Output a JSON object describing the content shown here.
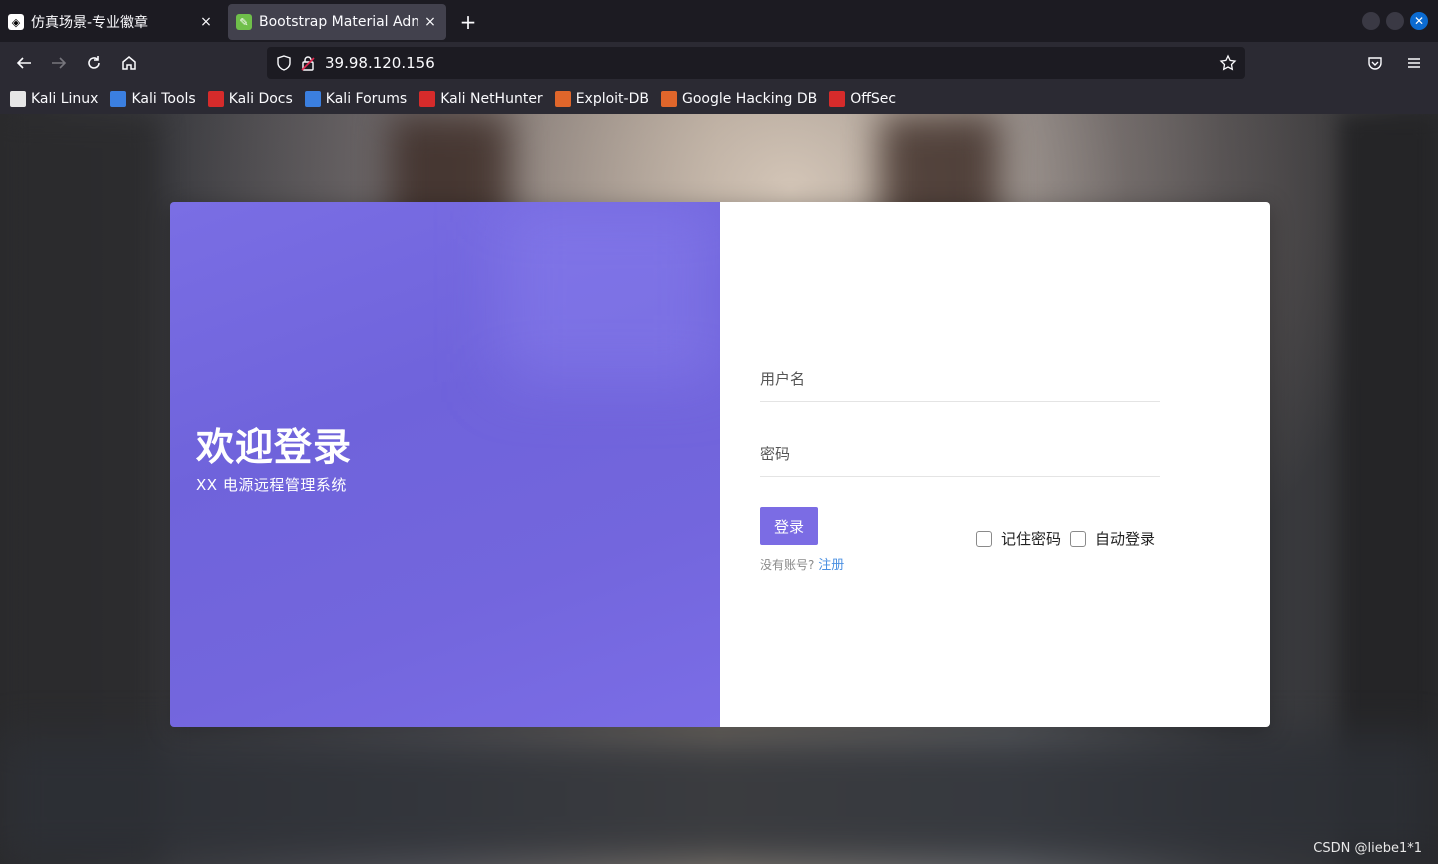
{
  "browser": {
    "tabs": [
      {
        "title": "仿真场景-专业徽章",
        "close": "×",
        "active": false
      },
      {
        "title": "Bootstrap Material Admin",
        "close": "×",
        "active": true
      }
    ],
    "new_tab": "+",
    "url": "39.98.120.156",
    "bookmarks": [
      {
        "label": "Kali Linux",
        "icon": "kali-dragon-icon",
        "color": "#e6e6e6"
      },
      {
        "label": "Kali Tools",
        "icon": "kali-tools-icon",
        "color": "#3b7fe0"
      },
      {
        "label": "Kali Docs",
        "icon": "kali-docs-icon",
        "color": "#d62b2b"
      },
      {
        "label": "Kali Forums",
        "icon": "kali-forums-icon",
        "color": "#3b7fe0"
      },
      {
        "label": "Kali NetHunter",
        "icon": "kali-nethunter-icon",
        "color": "#d62b2b"
      },
      {
        "label": "Exploit-DB",
        "icon": "exploit-db-icon",
        "color": "#e0662b"
      },
      {
        "label": "Google Hacking DB",
        "icon": "ghdb-icon",
        "color": "#e0662b"
      },
      {
        "label": "OffSec",
        "icon": "offsec-icon",
        "color": "#d62b2b"
      }
    ]
  },
  "login": {
    "welcome_title": "欢迎登录",
    "welcome_subtitle": "XX 电源远程管理系统",
    "username_placeholder": "用户名",
    "password_placeholder": "密码",
    "login_button": "登录",
    "no_account_text": "没有账号?",
    "register_link": "注册",
    "remember_password": "记住密码",
    "auto_login": "自动登录"
  },
  "watermark": "CSDN @liebe1*1",
  "colors": {
    "accent": "#7b6ce4",
    "panel_gradient_start": "#7a6ee4",
    "link": "#4a90e2"
  }
}
